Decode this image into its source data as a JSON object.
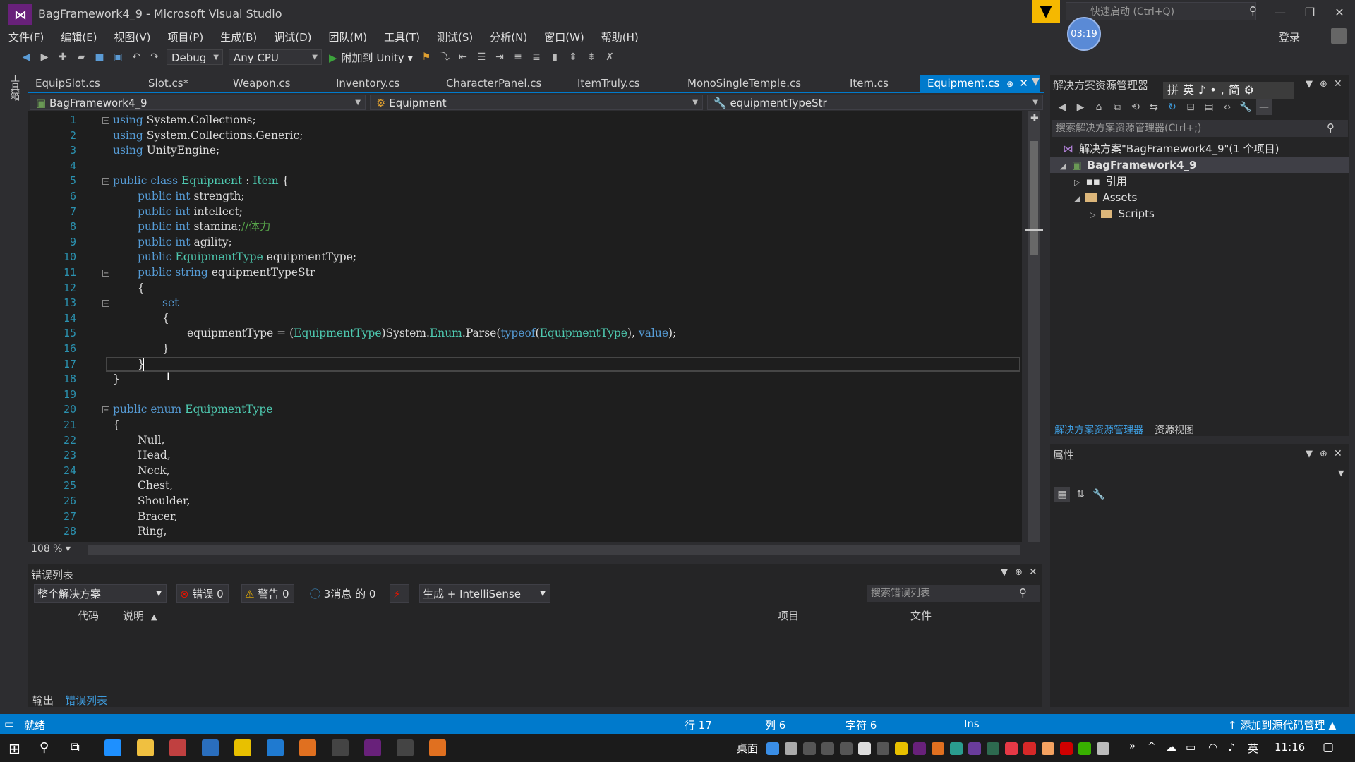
{
  "window": {
    "title": "BagFramework4_9 - Microsoft Visual Studio",
    "quick_launch_placeholder": "快速启动 (Ctrl+Q)",
    "timer": "03:19",
    "login": "登录"
  },
  "menu": [
    "文件(F)",
    "编辑(E)",
    "视图(V)",
    "项目(P)",
    "生成(B)",
    "调试(D)",
    "团队(M)",
    "工具(T)",
    "测试(S)",
    "分析(N)",
    "窗口(W)",
    "帮助(H)"
  ],
  "toolbar": {
    "config": "Debug",
    "platform": "Any CPU",
    "run_label": "附加到 Unity"
  },
  "toolbox_label": "工具箱",
  "tabs": [
    "EquipSlot.cs",
    "Slot.cs*",
    "Weapon.cs",
    "Inventory.cs",
    "CharacterPanel.cs",
    "ItemTruly.cs",
    "MonoSingleTemple.cs",
    "Item.cs",
    "Equipment.cs"
  ],
  "nav": {
    "project": "BagFramework4_9",
    "class": "Equipment",
    "member": "equipmentTypeStr"
  },
  "editor": {
    "zoom": "108 %"
  },
  "code_lines": [
    {
      "n": "1"
    },
    {
      "n": "2"
    },
    {
      "n": "3"
    },
    {
      "n": "4"
    },
    {
      "n": "5"
    },
    {
      "n": "6"
    },
    {
      "n": "7"
    },
    {
      "n": "8"
    },
    {
      "n": "9"
    },
    {
      "n": "10"
    },
    {
      "n": "11"
    },
    {
      "n": "12"
    },
    {
      "n": "13"
    },
    {
      "n": "14"
    },
    {
      "n": "15"
    },
    {
      "n": "16"
    },
    {
      "n": "17"
    },
    {
      "n": "18"
    },
    {
      "n": "19"
    },
    {
      "n": "20"
    },
    {
      "n": "21"
    },
    {
      "n": "22"
    },
    {
      "n": "23"
    },
    {
      "n": "24"
    },
    {
      "n": "25"
    },
    {
      "n": "26"
    },
    {
      "n": "27"
    },
    {
      "n": "28"
    }
  ],
  "code_text": {
    "l1": [
      "using",
      " System.Collections;"
    ],
    "l2": [
      "using",
      " System.Collections.Generic;"
    ],
    "l3": [
      "using",
      " UnityEngine;"
    ],
    "l5": [
      "public class",
      " ",
      "Equipment",
      " : ",
      "Item",
      " {"
    ],
    "l6": [
      "public int",
      " strength;"
    ],
    "l7": [
      "public int",
      " intellect;"
    ],
    "l8": [
      "public int",
      " stamina;",
      "//体力"
    ],
    "l9": [
      "public int",
      " agility;"
    ],
    "l10": [
      "public",
      " ",
      "EquipmentType",
      " equipmentType;"
    ],
    "l11": [
      "public string",
      " equipmentTypeStr"
    ],
    "l12": "{",
    "l13": "set",
    "l14": "{",
    "l15": [
      "equipmentType = (",
      "EquipmentType",
      ")System.",
      "Enum",
      ".Parse(",
      "typeof",
      "(",
      "EquipmentType",
      "), ",
      "value",
      ");"
    ],
    "l16": "}",
    "l17": "}",
    "l18": "}",
    "l20": [
      "public enum",
      " ",
      "EquipmentType"
    ],
    "l21": "{",
    "l22": "Null,",
    "l23": "Head,",
    "l24": "Neck,",
    "l25": "Chest,",
    "l26": "Shoulder,",
    "l27": "Bracer,",
    "l28": "Ring,"
  },
  "error_list": {
    "title": "错误列表",
    "scope": "整个解决方案",
    "errors": "错误 0",
    "warnings": "警告 0",
    "messages": "3消息 的 0",
    "build_filter": "生成 + IntelliSense",
    "search_placeholder": "搜索错误列表",
    "col_code": "代码",
    "col_desc": "说明",
    "col_project": "项目",
    "col_file": "文件"
  },
  "bottom_tabs": [
    "输出",
    "错误列表"
  ],
  "solution_explorer": {
    "title": "解决方案资源管理器",
    "ime": "拼英♪•,简⚙",
    "search_placeholder": "搜索解决方案资源管理器(Ctrl+;)",
    "solution": "解决方案\"BagFramework4_9\"(1 个项目)",
    "project": "BagFramework4_9",
    "references": "引用",
    "assets": "Assets",
    "scripts": "Scripts",
    "tabs": [
      "解决方案资源管理器",
      "资源视图"
    ]
  },
  "properties": {
    "title": "属性"
  },
  "status": {
    "ready": "就绪",
    "line": "行 17",
    "col": "列 6",
    "ch": "字符 6",
    "ins": "Ins",
    "source_control": "添加到源代码管理"
  },
  "taskbar": {
    "desktop": "桌面",
    "lang": "英",
    "time": "11:16"
  },
  "colors": {
    "accent": "#007acc",
    "keyword": "#569cd6",
    "type": "#4ec9b0",
    "comment": "#57a64a"
  }
}
